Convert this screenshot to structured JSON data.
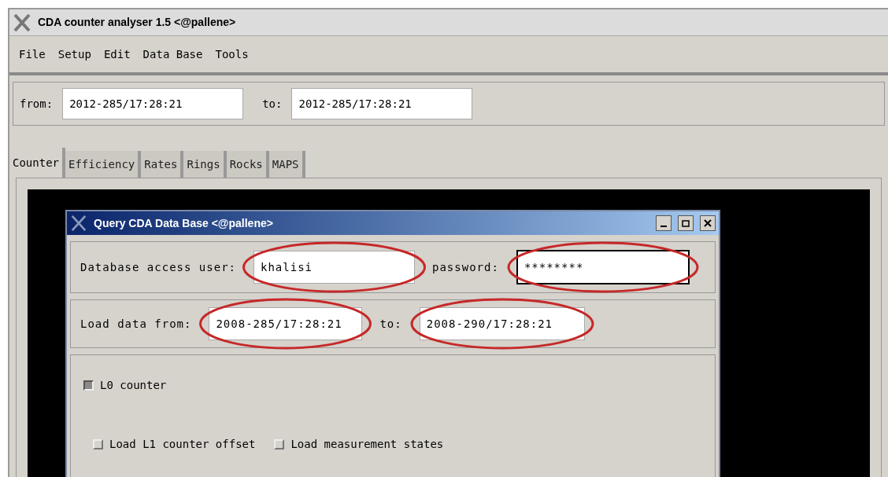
{
  "window": {
    "title": "CDA counter analyser 1.5 <@pallene>"
  },
  "menu": [
    "File",
    "Setup",
    "Edit",
    "Data Base",
    "Tools"
  ],
  "range": {
    "from_label": "from:",
    "from_value": "2012-285/17:28:21",
    "to_label": "to:",
    "to_value": "2012-285/17:28:21"
  },
  "tabs": [
    {
      "label": "Counter",
      "selected": true
    },
    {
      "label": "Efficiency",
      "selected": false
    },
    {
      "label": "Rates",
      "selected": false
    },
    {
      "label": "Rings",
      "selected": false
    },
    {
      "label": "Rocks",
      "selected": false
    },
    {
      "label": "MAPS",
      "selected": false
    }
  ],
  "dialog": {
    "title": "Query CDA Data Base <@pallene>",
    "user_label": "Database access user:",
    "user_value": "khalisi",
    "password_label": "password:",
    "password_value": "********",
    "load_from_label": "Load data from:",
    "load_from_value": "2008-285/17:28:21",
    "load_to_label": "to:",
    "load_to_value": "2008-290/17:28:21",
    "options": [
      {
        "label": "L0 counter",
        "checked": true
      },
      {
        "label": "Load L1 counter offset",
        "checked": false
      },
      {
        "label": "Load measurement states",
        "checked": false
      }
    ]
  }
}
